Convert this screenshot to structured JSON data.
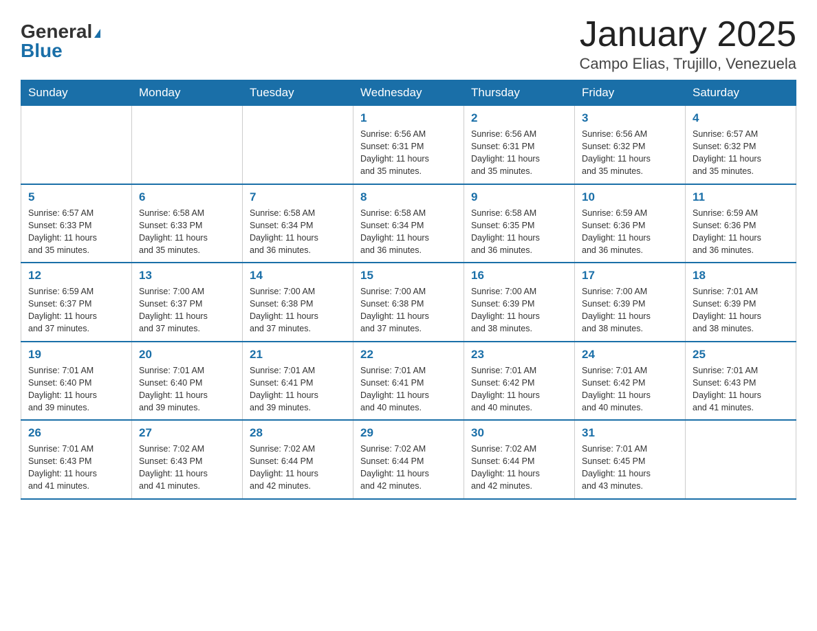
{
  "header": {
    "logo_general": "General",
    "logo_blue": "Blue",
    "title": "January 2025",
    "subtitle": "Campo Elias, Trujillo, Venezuela"
  },
  "days_of_week": [
    "Sunday",
    "Monday",
    "Tuesday",
    "Wednesday",
    "Thursday",
    "Friday",
    "Saturday"
  ],
  "weeks": [
    [
      {
        "day": "",
        "info": ""
      },
      {
        "day": "",
        "info": ""
      },
      {
        "day": "",
        "info": ""
      },
      {
        "day": "1",
        "info": "Sunrise: 6:56 AM\nSunset: 6:31 PM\nDaylight: 11 hours\nand 35 minutes."
      },
      {
        "day": "2",
        "info": "Sunrise: 6:56 AM\nSunset: 6:31 PM\nDaylight: 11 hours\nand 35 minutes."
      },
      {
        "day": "3",
        "info": "Sunrise: 6:56 AM\nSunset: 6:32 PM\nDaylight: 11 hours\nand 35 minutes."
      },
      {
        "day": "4",
        "info": "Sunrise: 6:57 AM\nSunset: 6:32 PM\nDaylight: 11 hours\nand 35 minutes."
      }
    ],
    [
      {
        "day": "5",
        "info": "Sunrise: 6:57 AM\nSunset: 6:33 PM\nDaylight: 11 hours\nand 35 minutes."
      },
      {
        "day": "6",
        "info": "Sunrise: 6:58 AM\nSunset: 6:33 PM\nDaylight: 11 hours\nand 35 minutes."
      },
      {
        "day": "7",
        "info": "Sunrise: 6:58 AM\nSunset: 6:34 PM\nDaylight: 11 hours\nand 36 minutes."
      },
      {
        "day": "8",
        "info": "Sunrise: 6:58 AM\nSunset: 6:34 PM\nDaylight: 11 hours\nand 36 minutes."
      },
      {
        "day": "9",
        "info": "Sunrise: 6:58 AM\nSunset: 6:35 PM\nDaylight: 11 hours\nand 36 minutes."
      },
      {
        "day": "10",
        "info": "Sunrise: 6:59 AM\nSunset: 6:36 PM\nDaylight: 11 hours\nand 36 minutes."
      },
      {
        "day": "11",
        "info": "Sunrise: 6:59 AM\nSunset: 6:36 PM\nDaylight: 11 hours\nand 36 minutes."
      }
    ],
    [
      {
        "day": "12",
        "info": "Sunrise: 6:59 AM\nSunset: 6:37 PM\nDaylight: 11 hours\nand 37 minutes."
      },
      {
        "day": "13",
        "info": "Sunrise: 7:00 AM\nSunset: 6:37 PM\nDaylight: 11 hours\nand 37 minutes."
      },
      {
        "day": "14",
        "info": "Sunrise: 7:00 AM\nSunset: 6:38 PM\nDaylight: 11 hours\nand 37 minutes."
      },
      {
        "day": "15",
        "info": "Sunrise: 7:00 AM\nSunset: 6:38 PM\nDaylight: 11 hours\nand 37 minutes."
      },
      {
        "day": "16",
        "info": "Sunrise: 7:00 AM\nSunset: 6:39 PM\nDaylight: 11 hours\nand 38 minutes."
      },
      {
        "day": "17",
        "info": "Sunrise: 7:00 AM\nSunset: 6:39 PM\nDaylight: 11 hours\nand 38 minutes."
      },
      {
        "day": "18",
        "info": "Sunrise: 7:01 AM\nSunset: 6:39 PM\nDaylight: 11 hours\nand 38 minutes."
      }
    ],
    [
      {
        "day": "19",
        "info": "Sunrise: 7:01 AM\nSunset: 6:40 PM\nDaylight: 11 hours\nand 39 minutes."
      },
      {
        "day": "20",
        "info": "Sunrise: 7:01 AM\nSunset: 6:40 PM\nDaylight: 11 hours\nand 39 minutes."
      },
      {
        "day": "21",
        "info": "Sunrise: 7:01 AM\nSunset: 6:41 PM\nDaylight: 11 hours\nand 39 minutes."
      },
      {
        "day": "22",
        "info": "Sunrise: 7:01 AM\nSunset: 6:41 PM\nDaylight: 11 hours\nand 40 minutes."
      },
      {
        "day": "23",
        "info": "Sunrise: 7:01 AM\nSunset: 6:42 PM\nDaylight: 11 hours\nand 40 minutes."
      },
      {
        "day": "24",
        "info": "Sunrise: 7:01 AM\nSunset: 6:42 PM\nDaylight: 11 hours\nand 40 minutes."
      },
      {
        "day": "25",
        "info": "Sunrise: 7:01 AM\nSunset: 6:43 PM\nDaylight: 11 hours\nand 41 minutes."
      }
    ],
    [
      {
        "day": "26",
        "info": "Sunrise: 7:01 AM\nSunset: 6:43 PM\nDaylight: 11 hours\nand 41 minutes."
      },
      {
        "day": "27",
        "info": "Sunrise: 7:02 AM\nSunset: 6:43 PM\nDaylight: 11 hours\nand 41 minutes."
      },
      {
        "day": "28",
        "info": "Sunrise: 7:02 AM\nSunset: 6:44 PM\nDaylight: 11 hours\nand 42 minutes."
      },
      {
        "day": "29",
        "info": "Sunrise: 7:02 AM\nSunset: 6:44 PM\nDaylight: 11 hours\nand 42 minutes."
      },
      {
        "day": "30",
        "info": "Sunrise: 7:02 AM\nSunset: 6:44 PM\nDaylight: 11 hours\nand 42 minutes."
      },
      {
        "day": "31",
        "info": "Sunrise: 7:01 AM\nSunset: 6:45 PM\nDaylight: 11 hours\nand 43 minutes."
      },
      {
        "day": "",
        "info": ""
      }
    ]
  ]
}
